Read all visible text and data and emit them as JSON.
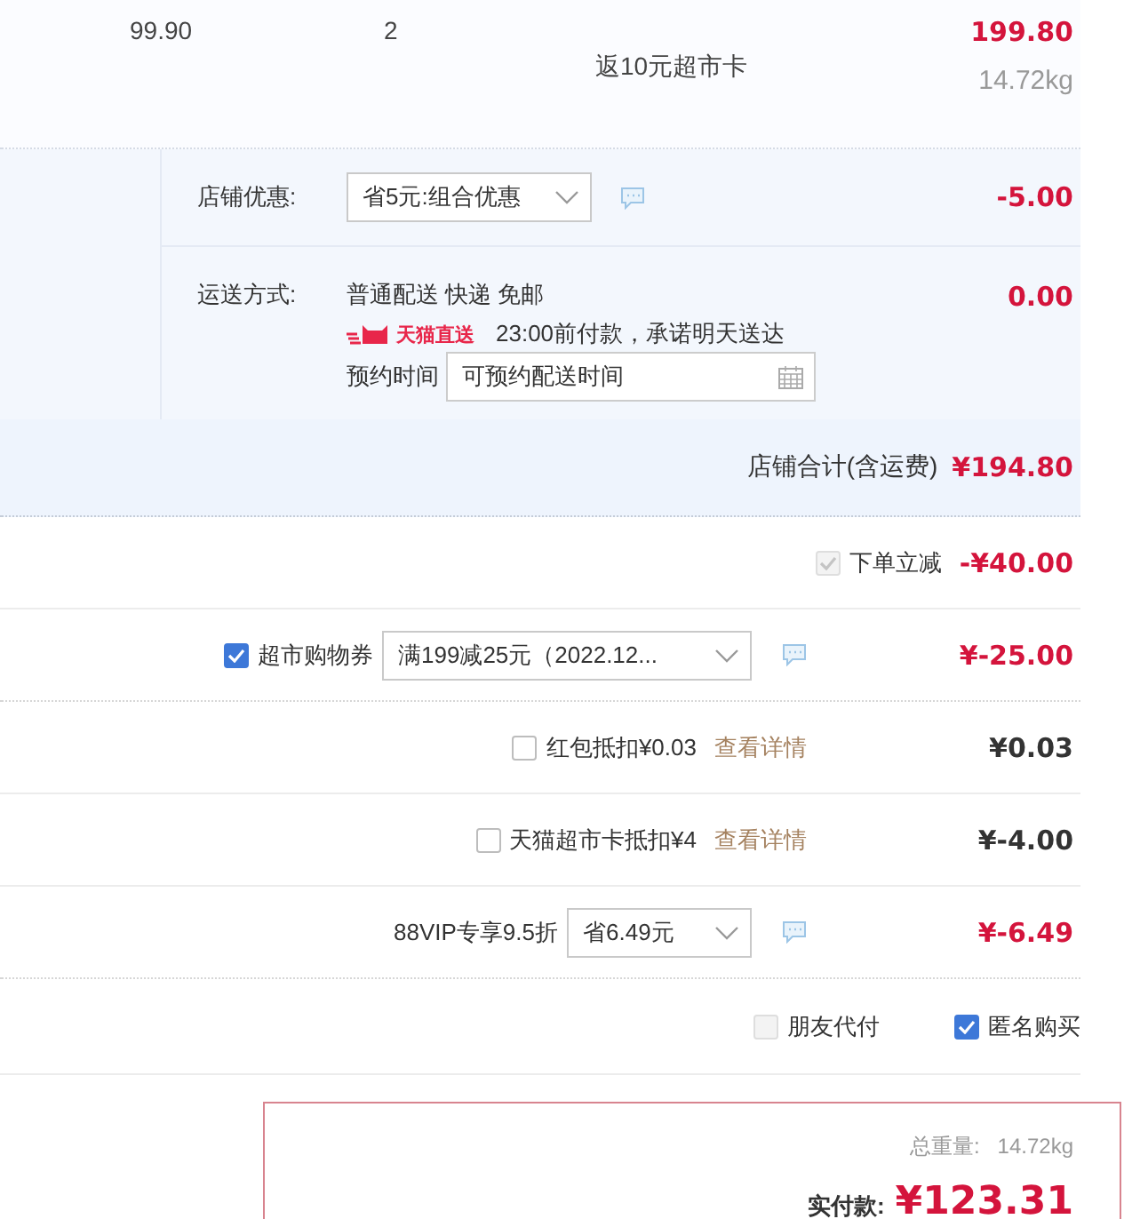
{
  "item": {
    "unit_price": "99.90",
    "quantity": "2",
    "promo": "返10元超市卡",
    "subtotal": "199.80",
    "weight": "14.72kg"
  },
  "shop": {
    "discount": {
      "label": "店铺优惠:",
      "value": "省5元:组合优惠",
      "amount": "-5.00"
    },
    "shipping": {
      "label": "运送方式:",
      "method": "普通配送 快递 免邮",
      "badge": "天猫直送",
      "promise": "23:00前付款，承诺明天送达",
      "schedule_label": "预约时间",
      "schedule_placeholder": "可预约配送时间",
      "amount": "0.00"
    },
    "total": {
      "label": "店铺合计(含运费)",
      "amount": "¥194.80"
    }
  },
  "adjustments": [
    {
      "kind": "discount",
      "checked": true,
      "disabled": true,
      "label": "下单立减",
      "amount": "-¥40.00",
      "color": "#d4143c"
    },
    {
      "kind": "coupon",
      "checked": true,
      "disabled": false,
      "label": "超市购物券",
      "value": "满199减25元（2022.12...",
      "amount": "¥-25.00",
      "color": "#d4143c"
    },
    {
      "kind": "credit",
      "checked": false,
      "disabled": false,
      "label": "红包抵扣¥0.03",
      "link": "查看详情",
      "amount": "¥0.03",
      "color": "#333333"
    },
    {
      "kind": "credit",
      "checked": false,
      "disabled": false,
      "label": "天猫超市卡抵扣¥4",
      "link": "查看详情",
      "amount": "¥-4.00",
      "color": "#333333"
    },
    {
      "kind": "coupon",
      "label": "88VIP专享9.5折",
      "value": "省6.49元",
      "amount": "¥-6.49",
      "color": "#d4143c"
    }
  ],
  "options": [
    {
      "label": "朋友代付",
      "checked": false,
      "disabled": true
    },
    {
      "label": "匿名购买",
      "checked": true,
      "disabled": false
    }
  ],
  "payment": {
    "weight_label": "总重量:",
    "weight": "14.72kg",
    "label": "实付款:",
    "amount": "¥123.31"
  }
}
